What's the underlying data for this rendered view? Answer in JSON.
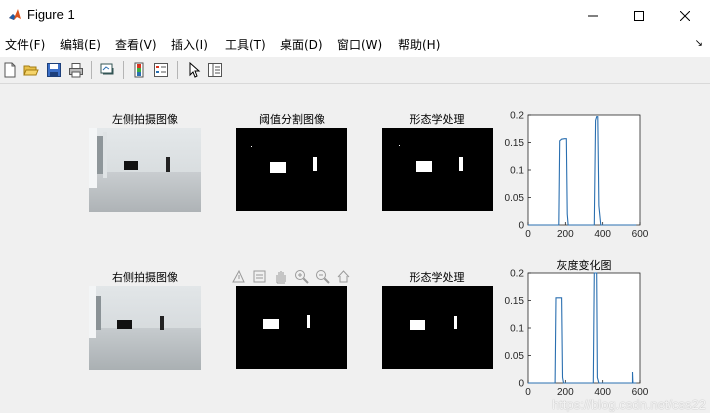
{
  "window": {
    "title": "Figure 1"
  },
  "menu": {
    "items": [
      {
        "label": "文件(F)"
      },
      {
        "label": "编辑(E)"
      },
      {
        "label": "查看(V)"
      },
      {
        "label": "插入(I)"
      },
      {
        "label": "工具(T)"
      },
      {
        "label": "桌面(D)"
      },
      {
        "label": "窗口(W)"
      },
      {
        "label": "帮助(H)"
      }
    ]
  },
  "toolbar": {
    "icons": [
      "new-figure-icon",
      "open-icon",
      "save-icon",
      "print-icon",
      "link-plot-icon",
      "colorbar-icon",
      "legend-icon",
      "edit-plot-icon",
      "property-inspector-icon"
    ]
  },
  "axes_tools": {
    "icons": [
      "export-icon",
      "brush-icon",
      "pan-icon",
      "zoom-in-icon",
      "zoom-out-icon",
      "home-icon"
    ]
  },
  "subplots": {
    "left_image_title": "左侧拍摄图像",
    "threshold_title": "阈值分割图像",
    "morph_title_top": "形态学处理",
    "right_image_title": "右侧拍摄图像",
    "morph_title_bottom": "形态学处理",
    "hist_title_bottom": "灰度变化图"
  },
  "colors": {
    "line": "#2a6fb0",
    "background": "#f0f0f0"
  },
  "watermark": "https://blog.csdn.net/css22",
  "chart_data": [
    {
      "type": "line",
      "title": "",
      "xlim": [
        0,
        600
      ],
      "ylim": [
        0,
        0.2
      ],
      "xticks": [
        0,
        200,
        400,
        600
      ],
      "yticks": [
        0,
        0.05,
        0.1,
        0.15,
        0.2
      ],
      "xtick_labels": [
        "0",
        "200",
        "400",
        "600"
      ],
      "ytick_labels": [
        "0",
        "0.05",
        "0.1",
        "0.15",
        "0.2"
      ],
      "x": [
        0,
        165,
        170,
        180,
        195,
        205,
        210,
        215,
        355,
        362,
        368,
        374,
        380,
        390,
        560,
        580
      ],
      "y": [
        0,
        0,
        0.153,
        0.156,
        0.157,
        0.157,
        0.02,
        0,
        0,
        0.19,
        0.197,
        0.197,
        0.035,
        0,
        0,
        0
      ]
    },
    {
      "type": "line",
      "title": "灰度变化图",
      "xlim": [
        0,
        600
      ],
      "ylim": [
        0,
        0.2
      ],
      "xticks": [
        0,
        200,
        400,
        600
      ],
      "yticks": [
        0,
        0.05,
        0.1,
        0.15,
        0.2
      ],
      "xtick_labels": [
        "0",
        "200",
        "400",
        "600"
      ],
      "ytick_labels": [
        "0",
        "0.05",
        "0.1",
        "0.15",
        "0.2"
      ],
      "x": [
        0,
        145,
        150,
        165,
        180,
        185,
        190,
        350,
        355,
        362,
        368,
        372,
        380,
        560,
        560,
        562,
        580
      ],
      "y": [
        0,
        0,
        0.155,
        0.155,
        0.155,
        0.01,
        0,
        0,
        0.2,
        0.2,
        0.2,
        0.01,
        0,
        0,
        0.02,
        0,
        0
      ]
    }
  ]
}
